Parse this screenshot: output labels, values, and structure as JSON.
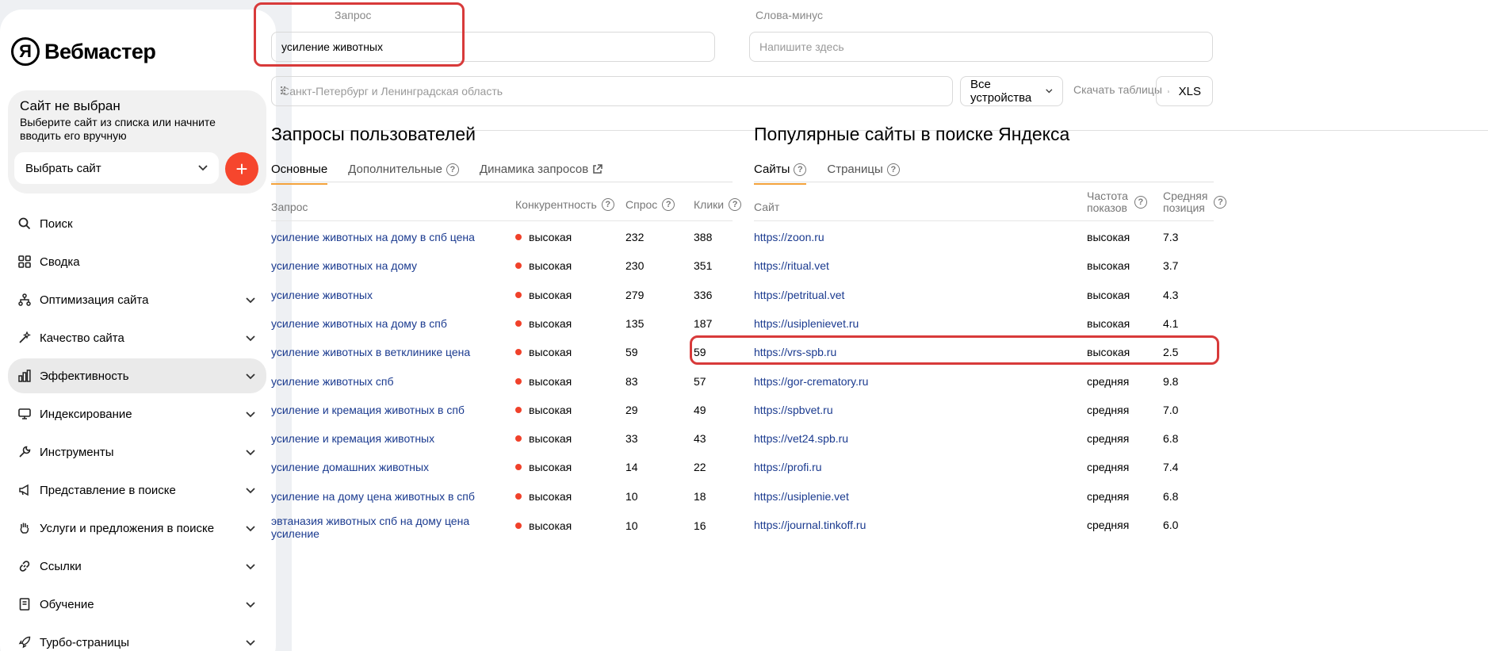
{
  "app": {
    "logo_letter": "Я",
    "logo_text": "Вебмастер"
  },
  "site": {
    "title": "Сайт не выбран",
    "description": "Выберите сайт из списка или начните вводить его вручную",
    "select_label": "Выбрать сайт",
    "add_label": "+"
  },
  "nav": [
    {
      "label": "Поиск",
      "icon": "search-icon",
      "chevron": false
    },
    {
      "label": "Сводка",
      "icon": "grid-icon",
      "chevron": false
    },
    {
      "label": "Оптимизация сайта",
      "icon": "sitemap-icon",
      "chevron": true
    },
    {
      "label": "Качество сайта",
      "icon": "magic-wand-icon",
      "chevron": true
    },
    {
      "label": "Эффективность",
      "icon": "bar-chart-icon",
      "chevron": true,
      "active": true
    },
    {
      "label": "Индексирование",
      "icon": "monitor-icon",
      "chevron": true
    },
    {
      "label": "Инструменты",
      "icon": "wrench-icon",
      "chevron": true
    },
    {
      "label": "Представление в поиске",
      "icon": "megaphone-icon",
      "chevron": true
    },
    {
      "label": "Услуги и предложения в поиске",
      "icon": "hand-icon",
      "chevron": true
    },
    {
      "label": "Ссылки",
      "icon": "link-icon",
      "chevron": true
    },
    {
      "label": "Обучение",
      "icon": "book-icon",
      "chevron": true
    },
    {
      "label": "Турбо-страницы",
      "icon": "rocket-icon",
      "chevron": true
    }
  ],
  "filters": {
    "query_label": "Запрос",
    "query_value": "усиление животных",
    "minus_label": "Слова-минус",
    "minus_placeholder": "Напишите здесь",
    "region_placeholder": "Санкт-Петербург и Ленинградская область",
    "devices_value": "Все устройства",
    "download_label": "Скачать таблицы",
    "xls_label": "XLS"
  },
  "queries": {
    "title": "Запросы пользователей",
    "tabs": [
      "Основные",
      "Дополнительные",
      "Динамика запросов"
    ],
    "headers": {
      "query": "Запрос",
      "competition": "Конкурентность",
      "demand": "Спрос",
      "clicks": "Клики"
    },
    "rows": [
      {
        "query": "усиление животных на дому в спб цена",
        "competition": "высокая",
        "demand": "232",
        "clicks": "388"
      },
      {
        "query": "усиление животных на дому",
        "competition": "высокая",
        "demand": "230",
        "clicks": "351"
      },
      {
        "query": "усиление животных",
        "competition": "высокая",
        "demand": "279",
        "clicks": "336"
      },
      {
        "query": "усиление животных на дому в спб",
        "competition": "высокая",
        "demand": "135",
        "clicks": "187"
      },
      {
        "query": "усиление животных в ветклинике цена",
        "competition": "высокая",
        "demand": "59",
        "clicks": "59"
      },
      {
        "query": "усиление животных спб",
        "competition": "высокая",
        "demand": "83",
        "clicks": "57"
      },
      {
        "query": "усиление и кремация животных в спб",
        "competition": "высокая",
        "demand": "29",
        "clicks": "49"
      },
      {
        "query": "усиление и кремация животных",
        "competition": "высокая",
        "demand": "33",
        "clicks": "43"
      },
      {
        "query": "усиление домашних животных",
        "competition": "высокая",
        "demand": "14",
        "clicks": "22"
      },
      {
        "query": "усиление на дому цена животных в спб",
        "competition": "высокая",
        "demand": "10",
        "clicks": "18"
      },
      {
        "query": "эвтаназия животных спб на дому цена",
        "query2": "усиление",
        "competition": "высокая",
        "demand": "10",
        "clicks": "16"
      }
    ]
  },
  "sites": {
    "title": "Популярные сайты в поиске Яндекса",
    "tabs": [
      "Сайты",
      "Страницы"
    ],
    "headers": {
      "site": "Сайт",
      "freq1": "Частота",
      "freq2": "показов",
      "pos1": "Средняя",
      "pos2": "позиция"
    },
    "rows": [
      {
        "site": "https://zoon.ru",
        "freq": "высокая",
        "pos": "7.3"
      },
      {
        "site": "https://ritual.vet",
        "freq": "высокая",
        "pos": "3.7"
      },
      {
        "site": "https://petritual.vet",
        "freq": "высокая",
        "pos": "4.3"
      },
      {
        "site": "https://usiplenievet.ru",
        "freq": "высокая",
        "pos": "4.1"
      },
      {
        "site": "https://vrs-spb.ru",
        "freq": "высокая",
        "pos": "2.5"
      },
      {
        "site": "https://gor-crematory.ru",
        "freq": "средняя",
        "pos": "9.8"
      },
      {
        "site": "https://spbvet.ru",
        "freq": "средняя",
        "pos": "7.0"
      },
      {
        "site": "https://vet24.spb.ru",
        "freq": "средняя",
        "pos": "6.8"
      },
      {
        "site": "https://profi.ru",
        "freq": "средняя",
        "pos": "7.4"
      },
      {
        "site": "https://usiplenie.vet",
        "freq": "средняя",
        "pos": "6.8"
      },
      {
        "site": "https://journal.tinkoff.ru",
        "freq": "средняя",
        "pos": "6.0"
      }
    ]
  },
  "colors": {
    "accent": "#f6462d",
    "link": "#1a3a8f",
    "highlight": "#d83a3a",
    "tab_underline": "#f3a23b"
  }
}
